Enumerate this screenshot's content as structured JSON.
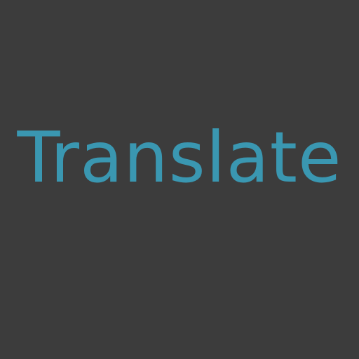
{
  "app_icon": {
    "label": "Translate",
    "background_color": "#3c3c3c",
    "text_color": "#3a97b1"
  }
}
